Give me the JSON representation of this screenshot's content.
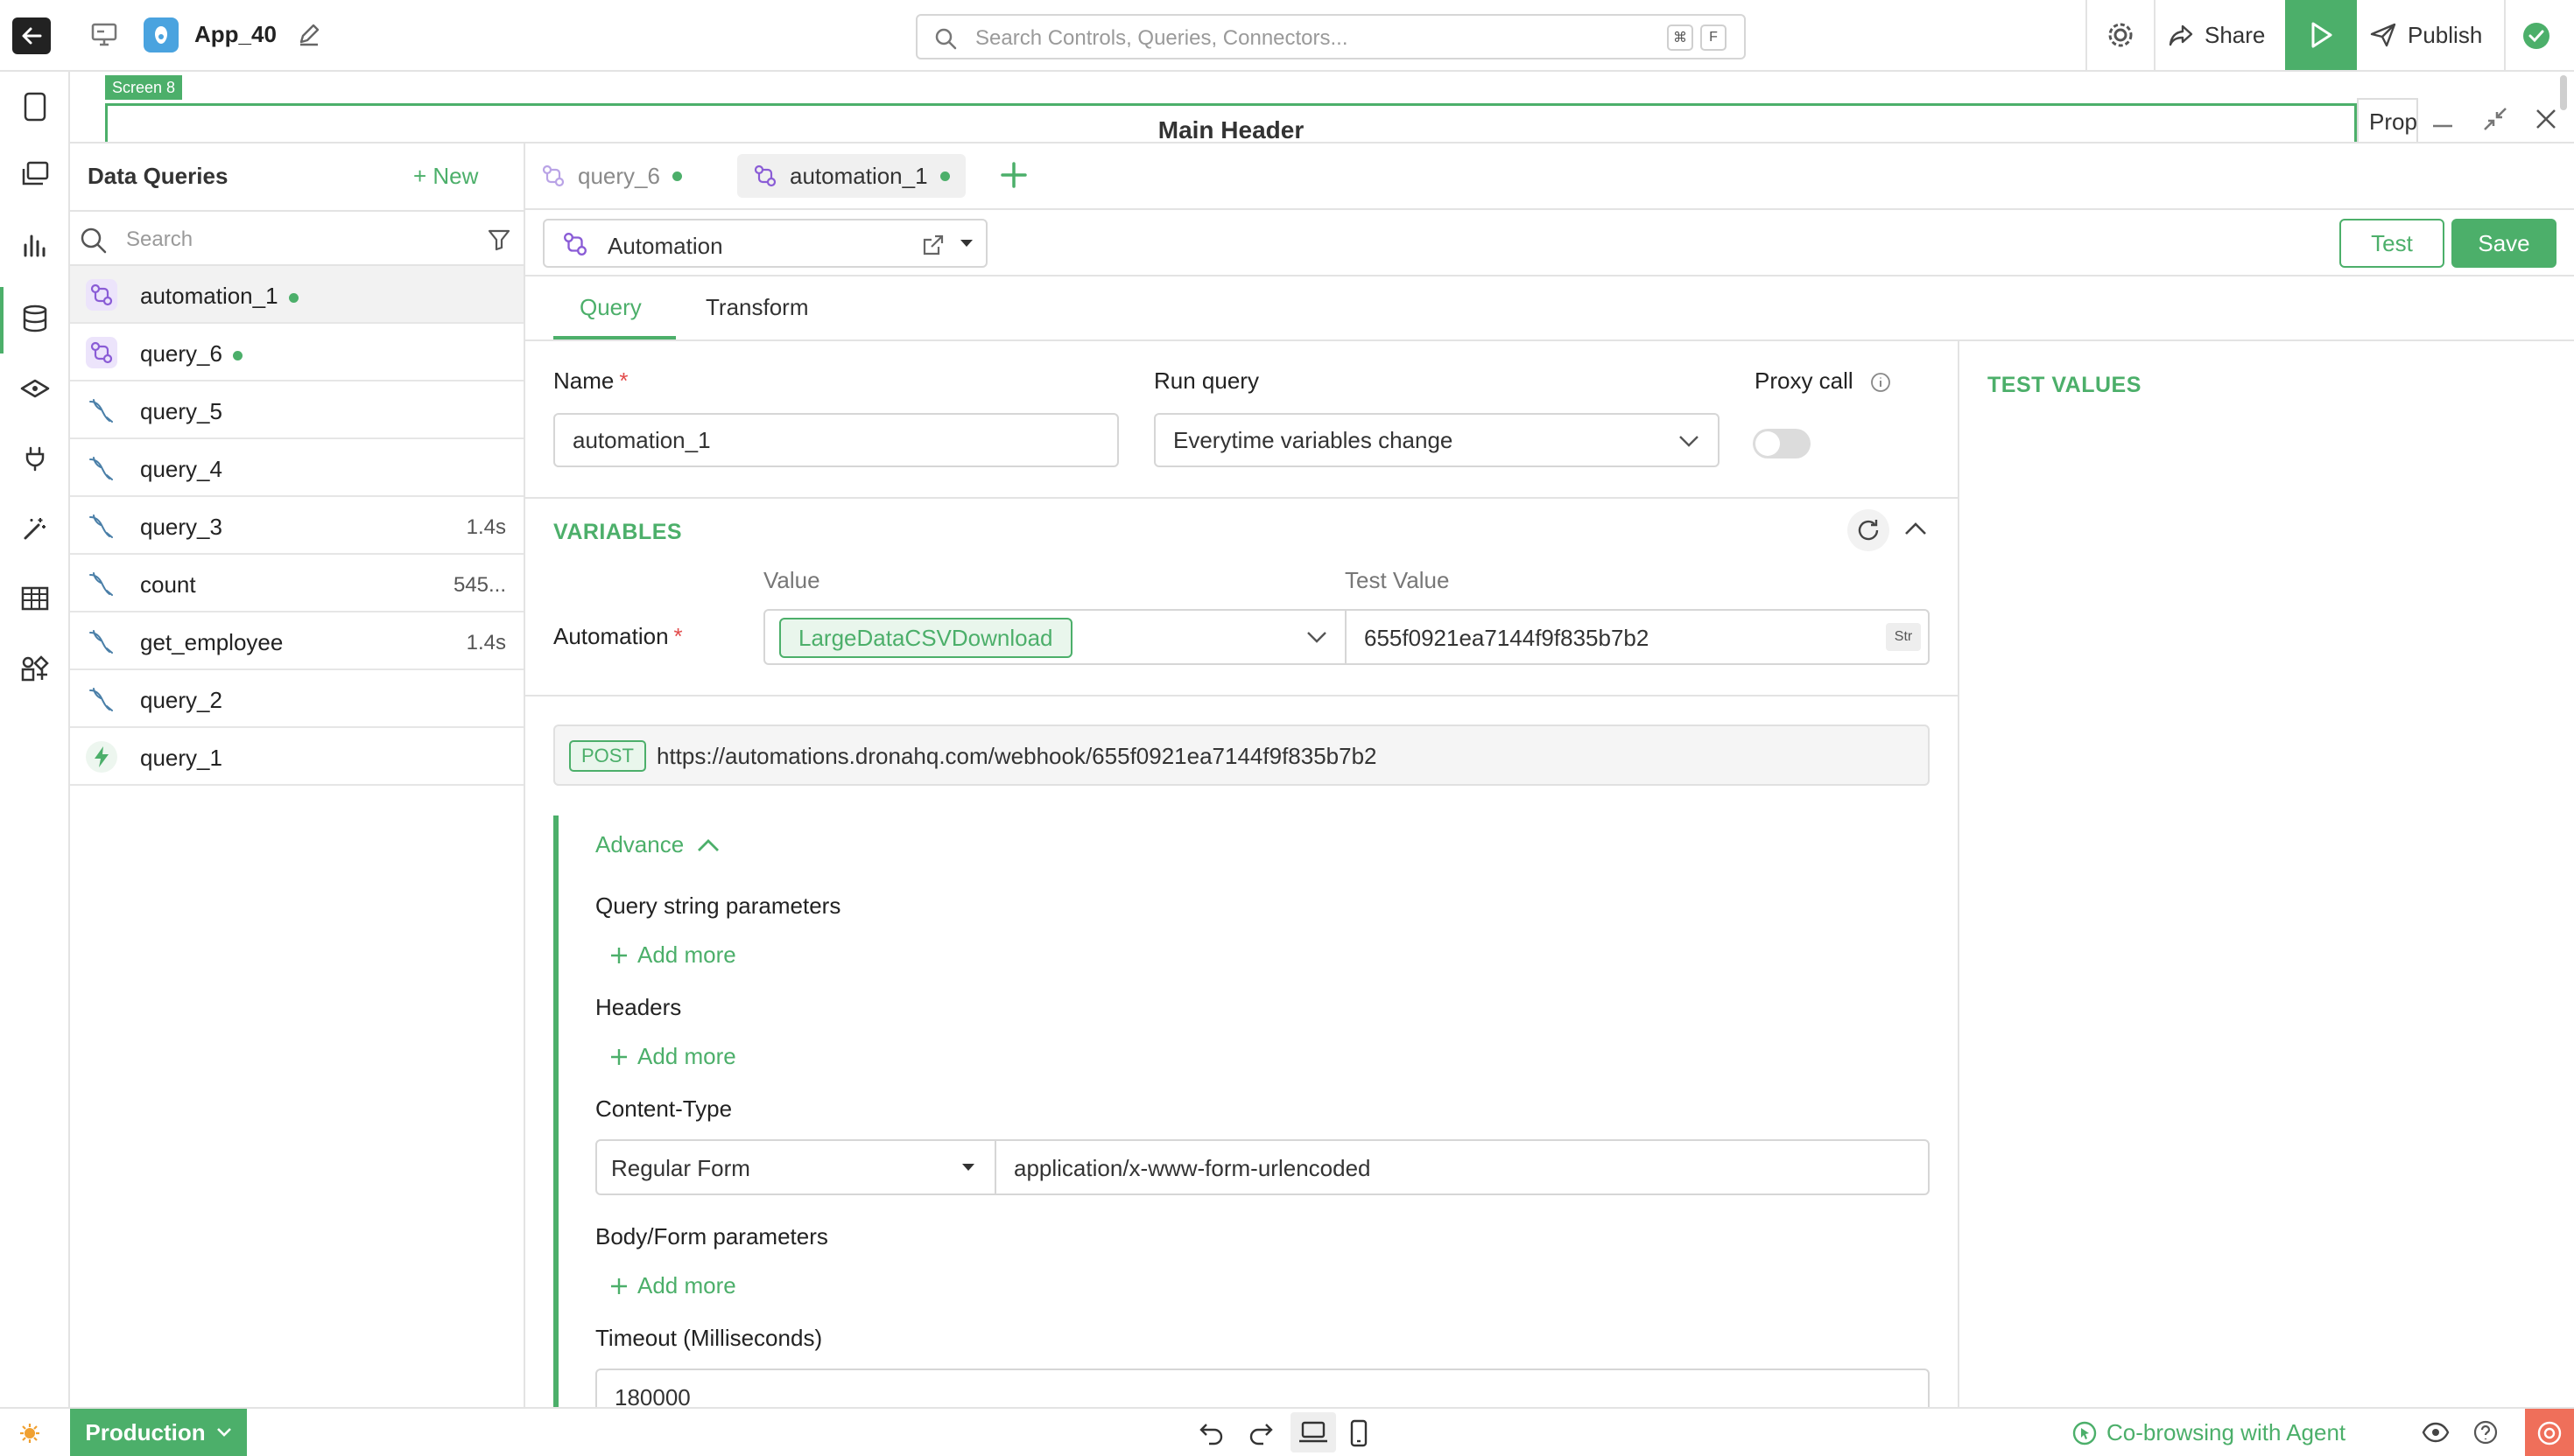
{
  "topbar": {
    "app_name": "App_40",
    "search_placeholder": "Search Controls, Queries, Connectors...",
    "shortcut_keys": [
      "⌘",
      "F"
    ],
    "share_label": "Share",
    "publish_label": "Publish"
  },
  "canvas": {
    "screen_tag": "Screen 8",
    "main_header": "Main Header",
    "props_tab": "Prop"
  },
  "data_queries": {
    "title": "Data Queries",
    "new_label": "+ New",
    "search_placeholder": "Search",
    "items": [
      {
        "name": "automation_1",
        "type": "automation",
        "time": "",
        "active": true,
        "dot": true
      },
      {
        "name": "query_6",
        "type": "automation",
        "time": "",
        "active": false,
        "dot": true
      },
      {
        "name": "query_5",
        "type": "mysql",
        "time": "",
        "active": false,
        "dot": false
      },
      {
        "name": "query_4",
        "type": "mysql",
        "time": "",
        "active": false,
        "dot": false
      },
      {
        "name": "query_3",
        "type": "mysql",
        "time": "1.4s",
        "active": false,
        "dot": false
      },
      {
        "name": "count",
        "type": "mysql",
        "time": "545...",
        "active": false,
        "dot": false
      },
      {
        "name": "get_employee",
        "type": "mysql",
        "time": "1.4s",
        "active": false,
        "dot": false
      },
      {
        "name": "query_2",
        "type": "mysql",
        "time": "",
        "active": false,
        "dot": false
      },
      {
        "name": "query_1",
        "type": "lightning",
        "time": "",
        "active": false,
        "dot": false
      }
    ]
  },
  "editor": {
    "tabs": [
      {
        "label": "query_6",
        "active": false
      },
      {
        "label": "automation_1",
        "active": true
      }
    ],
    "connector": "Automation",
    "test_label": "Test",
    "save_label": "Save",
    "sub_tabs": {
      "query": "Query",
      "transform": "Transform"
    },
    "name_label": "Name",
    "name_value": "automation_1",
    "run_query_label": "Run query",
    "run_query_value": "Everytime variables change",
    "proxy_label": "Proxy call",
    "proxy_enabled": false,
    "test_values_title": "TEST VALUES",
    "variables": {
      "title": "VARIABLES",
      "col_value": "Value",
      "col_test_value": "Test Value",
      "row_label": "Automation",
      "chip": "LargeDataCSVDownload",
      "test_value": "655f0921ea7144f9f835b7b2",
      "type_badge": "Str"
    },
    "request": {
      "method": "POST",
      "url": "https://automations.dronahq.com/webhook/655f0921ea7144f9f835b7b2"
    },
    "advance": {
      "title": "Advance",
      "query_params_label": "Query string parameters",
      "headers_label": "Headers",
      "add_more_label": "Add more",
      "content_type_label": "Content-Type",
      "content_type_select": "Regular Form",
      "content_type_value": "application/x-www-form-urlencoded",
      "body_params_label": "Body/Form parameters",
      "timeout_label": "Timeout (Milliseconds)",
      "timeout_value": "180000"
    }
  },
  "bottombar": {
    "env_label": "Production",
    "cobrowse_label": "Co-browsing with Agent"
  },
  "colors": {
    "accent": "#4caf6a",
    "automation_icon": "#8a5cd6",
    "mysql_icon": "#4a7fa8",
    "required": "#e24b4b"
  }
}
